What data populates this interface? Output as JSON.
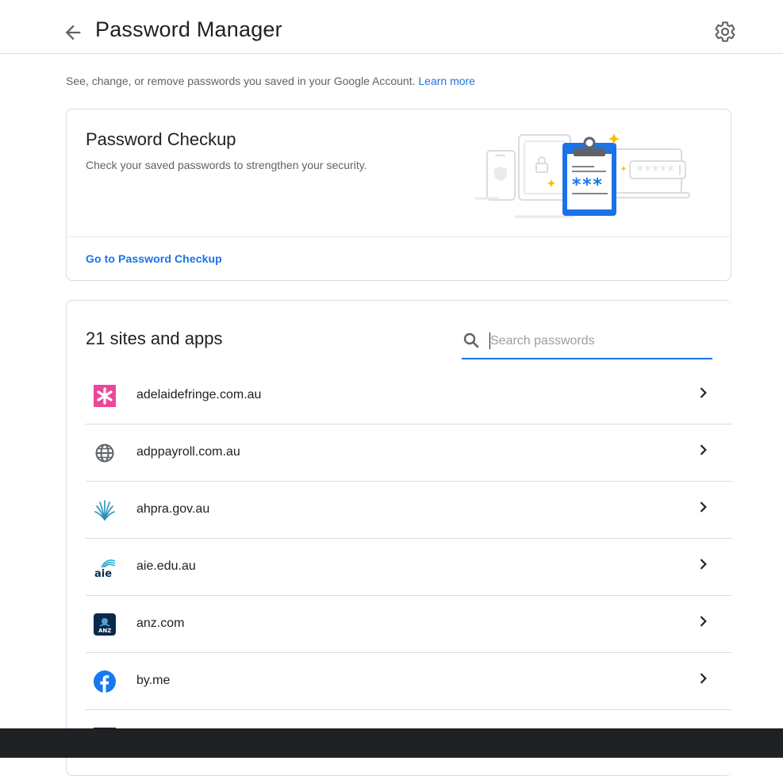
{
  "header": {
    "title": "Password Manager"
  },
  "intro": {
    "text": "See, change, or remove passwords you saved in your Google Account.",
    "learn_more": "Learn more"
  },
  "checkup": {
    "title": "Password Checkup",
    "description": "Check your saved passwords to strengthen your security.",
    "link": "Go to Password Checkup"
  },
  "passwords": {
    "title": "21 sites and apps",
    "search_placeholder": "Search passwords",
    "items": [
      {
        "site": "adelaidefringe.com.au",
        "icon": "adelaide-fringe-icon"
      },
      {
        "site": "adppayroll.com.au",
        "icon": "globe-icon"
      },
      {
        "site": "ahpra.gov.au",
        "icon": "ahpra-icon"
      },
      {
        "site": "aie.edu.au",
        "icon": "aie-icon"
      },
      {
        "site": "anz.com",
        "icon": "anz-icon"
      },
      {
        "site": "by.me",
        "icon": "facebook-icon"
      }
    ]
  },
  "colors": {
    "accent": "#1a73e8",
    "text": "#202124",
    "secondary_text": "#5f6368",
    "divider": "#dadce0",
    "taskbar": "#202124"
  }
}
